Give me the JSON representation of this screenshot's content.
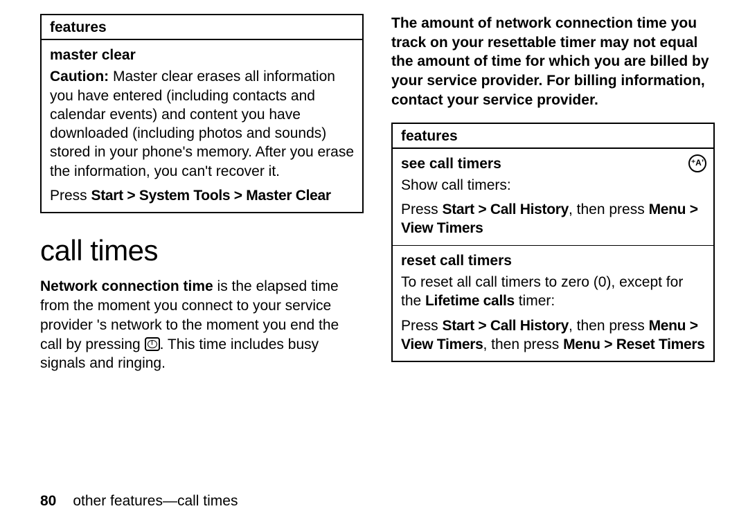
{
  "left": {
    "table": {
      "header": "features",
      "row": {
        "title": "master clear",
        "caution_label": "Caution:",
        "caution_text": " Master clear erases all information you have entered (including contacts and calendar events) and content you have downloaded (including photos and sounds) stored in your phone's memory. After you erase the information, you can't recover it.",
        "press_prefix": "Press ",
        "nav": "Start > System Tools > Master Clear"
      }
    },
    "section_heading": "call times",
    "net_bold": "Network connection time",
    "net_rest_a": " is the elapsed time from the moment you connect to your service provider 's network to the moment you end the call by pressing ",
    "net_rest_b": ". This time includes busy signals and ringing."
  },
  "right": {
    "intro": "The amount of network connection time you track on your resettable timer may not equal the amount of time for which you are billed by your service provider. For billing information, contact your service provider.",
    "table": {
      "header": "features",
      "row1": {
        "title": "see call timers",
        "desc": "Show call timers:",
        "press_prefix": "Press ",
        "nav1": "Start > Call History",
        "middle": ", then press ",
        "nav2": "Menu > View Timers"
      },
      "row2": {
        "title": "reset call timers",
        "desc_a": "To reset all call timers to zero (0), except for the ",
        "lifetime": "Lifetime calls",
        "desc_b": " timer:",
        "press_prefix": "Press ",
        "nav1": "Start > Call History",
        "middle": ", then press ",
        "nav2": "Menu > View Timers",
        "then": ", then press ",
        "nav3": "Menu > Reset Timers"
      }
    }
  },
  "footer": {
    "page": "80",
    "text": "other features—call times"
  },
  "icons": {
    "antenna": "A"
  }
}
